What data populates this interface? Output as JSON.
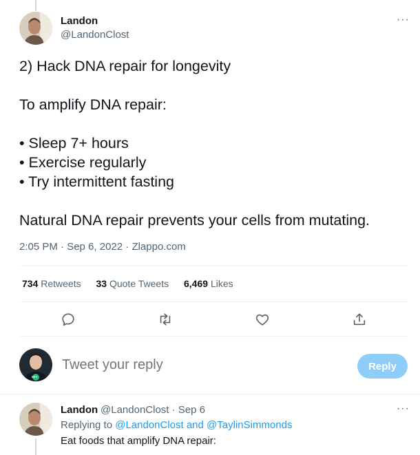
{
  "main_tweet": {
    "author_name": "Landon",
    "author_handle": "@LandonClost",
    "more_label": "···",
    "lines": [
      "2) Hack DNA repair for longevity",
      "",
      "To amplify DNA repair:",
      "",
      "• Sleep 7+ hours",
      "• Exercise regularly",
      "• Try intermittent fasting",
      "",
      "Natural DNA repair prevents your cells from mutating."
    ],
    "time": "2:05 PM · Sep 6, 2022 · ",
    "source": "Zlappo.com"
  },
  "stats": {
    "retweets_count": "734",
    "retweets_label": "Retweets",
    "quotes_count": "33",
    "quotes_label": "Quote Tweets",
    "likes_count": "6,469",
    "likes_label": "Likes"
  },
  "actions": [
    "reply-icon",
    "retweet-icon",
    "like-icon",
    "share-icon"
  ],
  "composer": {
    "placeholder": "Tweet your reply",
    "reply_button": "Reply",
    "avatar_badge": "RPV"
  },
  "reply_tweet": {
    "author_name": "Landon",
    "handle_time": "@LandonClost · Sep 6",
    "more_label": "···",
    "replying_prefix": "Replying to ",
    "replying_to": "@LandonClost and @TaylinSimmonds",
    "text": "Eat foods that amplify DNA repair:"
  },
  "colors": {
    "accent": "#1d9bf0",
    "reply_button_bg": "#8ecdf8",
    "muted": "#536471"
  }
}
